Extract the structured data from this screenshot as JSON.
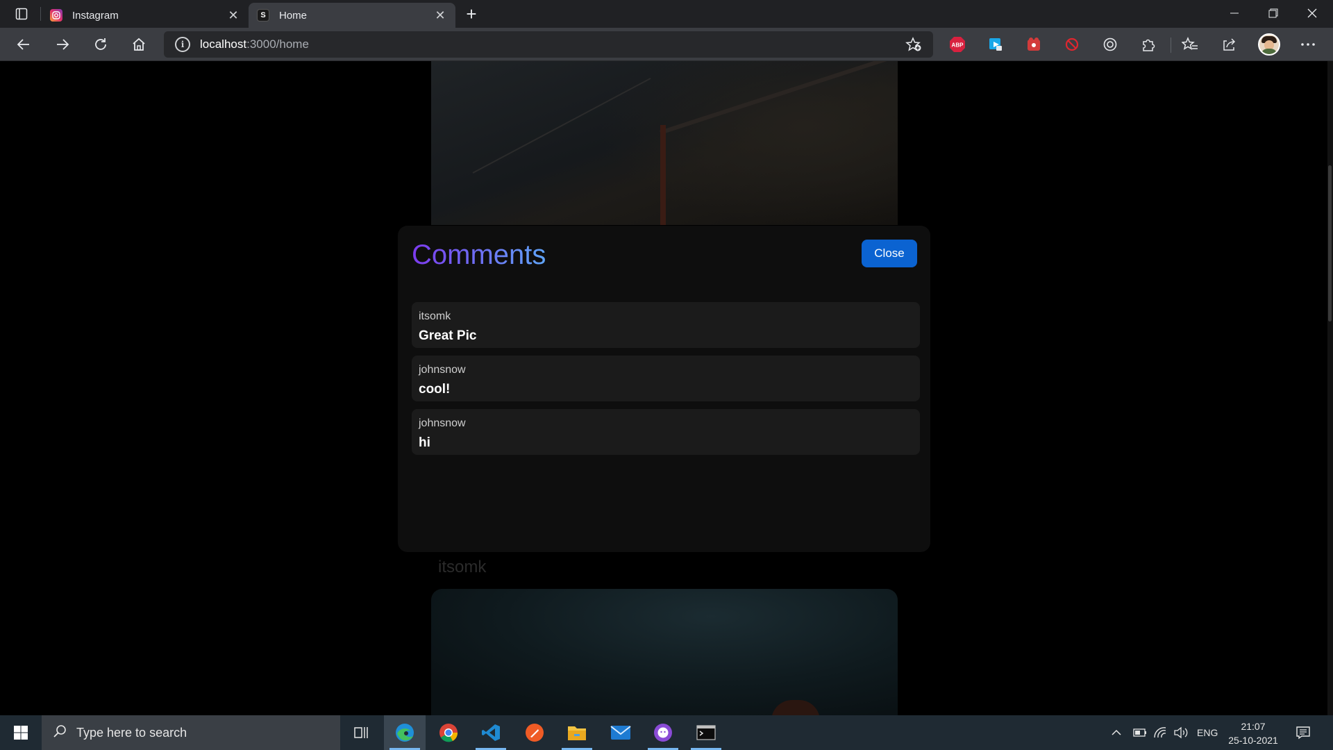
{
  "browser": {
    "tabs": [
      {
        "title": "Instagram",
        "favicon": "instagram-icon",
        "active": false
      },
      {
        "title": "Home",
        "favicon": "s-icon",
        "active": true
      }
    ],
    "url_host": "localhost",
    "url_rest": ":3000/home",
    "extensions": [
      "adblock-plus-icon",
      "send-icon",
      "extension-red-icon",
      "blocked-icon",
      "record-icon",
      "extensions-icon"
    ]
  },
  "page": {
    "post_username": "itsomk",
    "modal": {
      "title": "Comments",
      "close_label": "Close",
      "title_gradient": [
        "#7c3aed",
        "#60a5fa"
      ],
      "close_color": "#0b63d1",
      "comments": [
        {
          "user": "itsomk",
          "text": "Great Pic"
        },
        {
          "user": "johnsnow",
          "text": "cool!"
        },
        {
          "user": "johnsnow",
          "text": "hi"
        }
      ]
    }
  },
  "taskbar": {
    "search_placeholder": "Type here to search",
    "apps": [
      "edge-icon",
      "chrome-icon",
      "vscode-icon",
      "postman-icon",
      "file-explorer-icon",
      "mail-icon",
      "github-desktop-icon",
      "terminal-icon"
    ],
    "language": "ENG",
    "time": "21:07",
    "date": "25-10-2021"
  }
}
